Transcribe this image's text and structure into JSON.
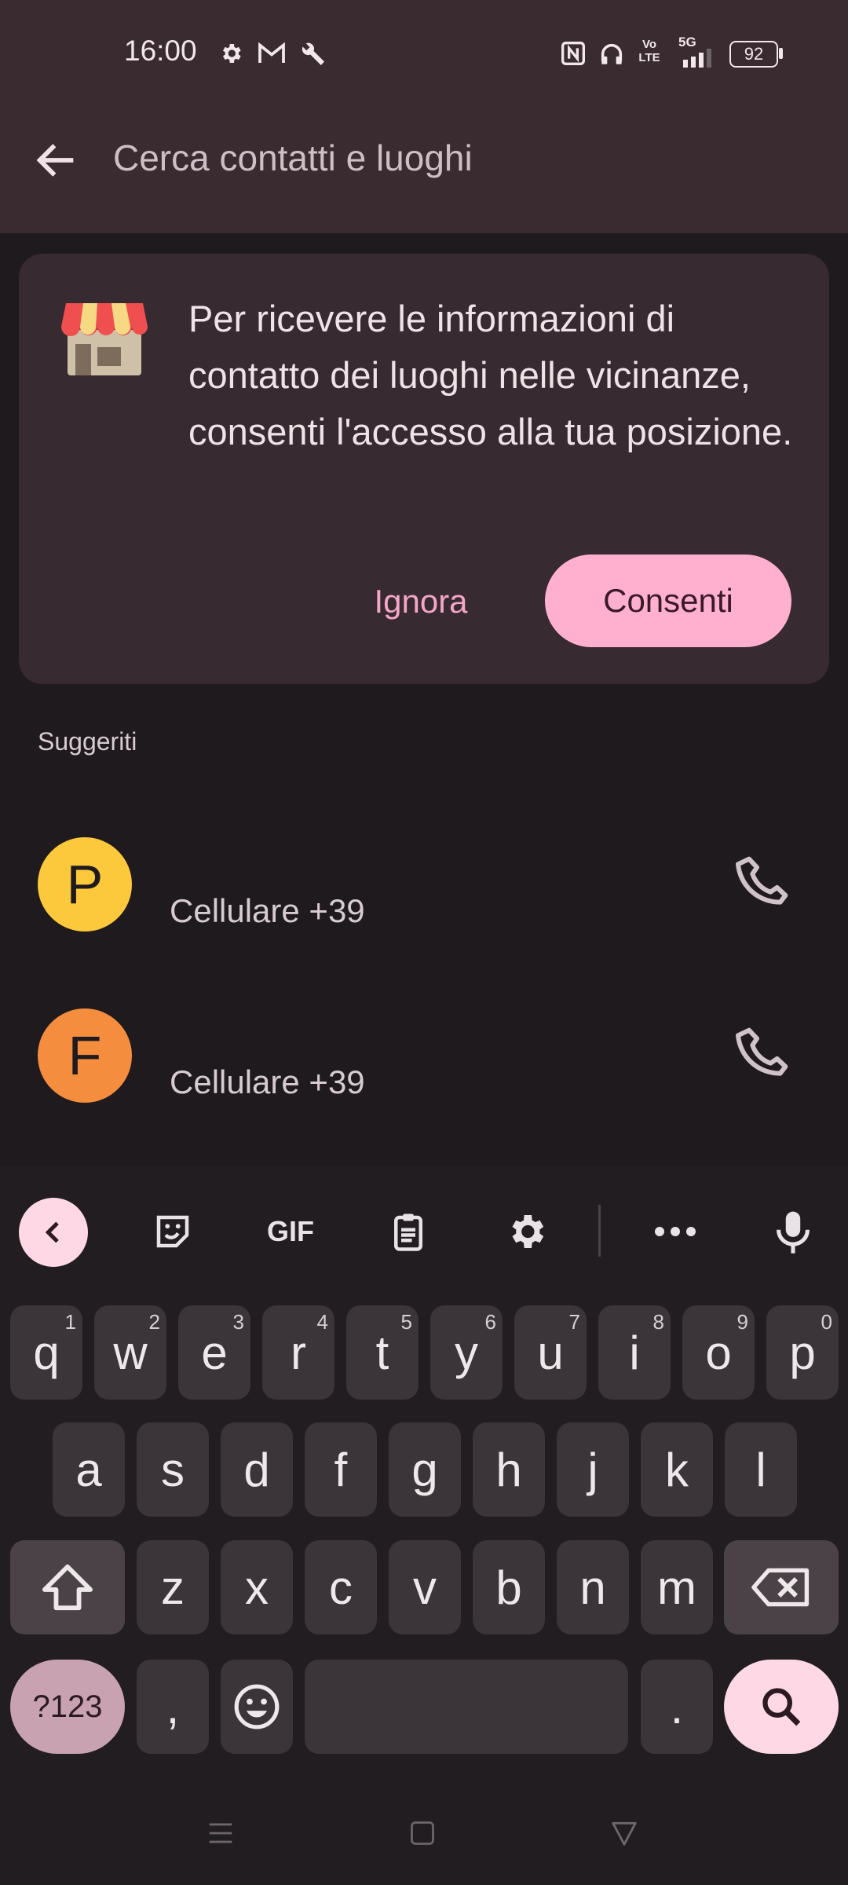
{
  "status_bar": {
    "time": "16:00",
    "battery": "92",
    "network": "5G",
    "volte": "Vo LTE",
    "left_icons": [
      "settings-icon",
      "gmail-icon",
      "wrench-icon"
    ],
    "right_icons": [
      "nfc-icon",
      "headphones-icon",
      "volte-icon",
      "signal-5g-icon",
      "battery-icon"
    ]
  },
  "search_bar": {
    "placeholder": "Cerca contatti e luoghi"
  },
  "permission_card": {
    "message": "Per ricevere le informazioni di contatto dei luoghi nelle vicinanze, consenti l'accesso alla tua posizione.",
    "dismiss_label": "Ignora",
    "allow_label": "Consenti"
  },
  "suggestions": {
    "heading": "Suggeriti",
    "contacts": [
      {
        "initial": "P",
        "detail": "Cellulare +39",
        "avatar_color": "#fbc93b"
      },
      {
        "initial": "F",
        "detail": "Cellulare +39",
        "avatar_color": "#f58d3f"
      }
    ]
  },
  "keyboard": {
    "toolbar": [
      "back-icon",
      "sticker-icon",
      "GIF",
      "clipboard-icon",
      "settings-icon",
      "more-icon",
      "microphone-icon"
    ],
    "gif_label": "GIF",
    "row1": [
      {
        "k": "q",
        "n": "1"
      },
      {
        "k": "w",
        "n": "2"
      },
      {
        "k": "e",
        "n": "3"
      },
      {
        "k": "r",
        "n": "4"
      },
      {
        "k": "t",
        "n": "5"
      },
      {
        "k": "y",
        "n": "6"
      },
      {
        "k": "u",
        "n": "7"
      },
      {
        "k": "i",
        "n": "8"
      },
      {
        "k": "o",
        "n": "9"
      },
      {
        "k": "p",
        "n": "0"
      }
    ],
    "row2": [
      "a",
      "s",
      "d",
      "f",
      "g",
      "h",
      "j",
      "k",
      "l"
    ],
    "row3": [
      "z",
      "x",
      "c",
      "v",
      "b",
      "n",
      "m"
    ],
    "symbols_label": "?123",
    "comma": ",",
    "period": "."
  },
  "colors": {
    "accent": "#ffb0cf",
    "card": "#372a30",
    "background": "#1f1a1d"
  }
}
